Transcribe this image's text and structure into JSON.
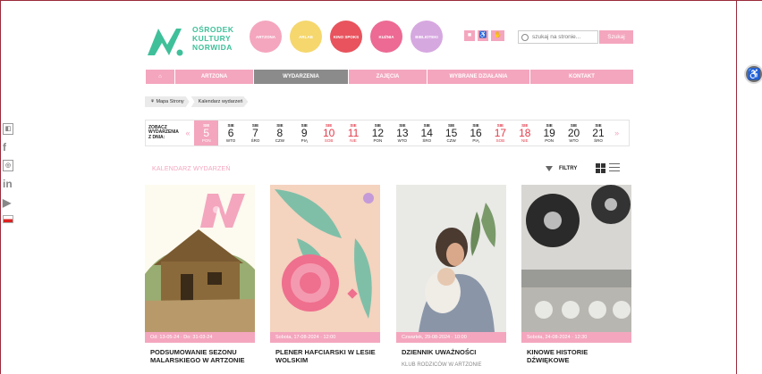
{
  "logo": {
    "line1": "OŚRODEK",
    "line2": "KULTURY",
    "line3": "NORWIDA"
  },
  "circles": [
    {
      "label": "ARTZONA",
      "color": "#f4a6be"
    },
    {
      "label": "ARLAB",
      "color": "#f5d76e"
    },
    {
      "label": "KINO SPOKS",
      "color": "#e8535d"
    },
    {
      "label": "KUŹNIA",
      "color": "#ec6a94"
    },
    {
      "label": "BIBLIOTEKI",
      "color": "#d6a8e0"
    }
  ],
  "search": {
    "placeholder": "szukaj na stronie...",
    "button": "Szukaj"
  },
  "nav": [
    {
      "label": "⌂",
      "active": false
    },
    {
      "label": "ARTZONA",
      "active": false
    },
    {
      "label": "WYDARZENIA",
      "active": true
    },
    {
      "label": "ZAJĘCIA",
      "active": false
    },
    {
      "label": "WYBRANE DZIAŁANIA",
      "active": false
    },
    {
      "label": "KONTAKT",
      "active": false
    }
  ],
  "breadcrumb": {
    "home": "Mapa Strony",
    "current": "Kalendarz wydarzeń"
  },
  "calendar": {
    "label": "ZOBACZ WYDARZENIA Z DNIA:",
    "days": [
      {
        "m": "SIE",
        "d": "5",
        "w": "PON",
        "red": false,
        "sel": true
      },
      {
        "m": "SIE",
        "d": "6",
        "w": "WTO",
        "red": false,
        "sel": false
      },
      {
        "m": "SIE",
        "d": "7",
        "w": "ŚRO",
        "red": false,
        "sel": false
      },
      {
        "m": "SIE",
        "d": "8",
        "w": "CZW",
        "red": false,
        "sel": false
      },
      {
        "m": "SIE",
        "d": "9",
        "w": "PIĄ",
        "red": false,
        "sel": false
      },
      {
        "m": "SIE",
        "d": "10",
        "w": "SOB",
        "red": true,
        "sel": false
      },
      {
        "m": "SIE",
        "d": "11",
        "w": "NIE",
        "red": true,
        "sel": false
      },
      {
        "m": "SIE",
        "d": "12",
        "w": "PON",
        "red": false,
        "sel": false
      },
      {
        "m": "SIE",
        "d": "13",
        "w": "WTO",
        "red": false,
        "sel": false
      },
      {
        "m": "SIE",
        "d": "14",
        "w": "ŚRO",
        "red": false,
        "sel": false
      },
      {
        "m": "SIE",
        "d": "15",
        "w": "CZW",
        "red": false,
        "sel": false
      },
      {
        "m": "SIE",
        "d": "16",
        "w": "PIĄ",
        "red": false,
        "sel": false
      },
      {
        "m": "SIE",
        "d": "17",
        "w": "SOB",
        "red": true,
        "sel": false
      },
      {
        "m": "SIE",
        "d": "18",
        "w": "NIE",
        "red": true,
        "sel": false
      },
      {
        "m": "SIE",
        "d": "19",
        "w": "PON",
        "red": false,
        "sel": false
      },
      {
        "m": "SIE",
        "d": "20",
        "w": "WTO",
        "red": false,
        "sel": false
      },
      {
        "m": "SIE",
        "d": "21",
        "w": "ŚRO",
        "red": false,
        "sel": false
      }
    ]
  },
  "section_title": "KALENDARZ WYDARZEŃ",
  "filter_label": "FILTRY",
  "cards": [
    {
      "date": "Od: 13-05-24 · Do: 31-03-24",
      "title": "PODSUMOWANIE SEZONU MALARSKIEGO W ARTZONIE",
      "sub": ""
    },
    {
      "date": "Sobota, 17-08-2024 · 12:00",
      "title": "PLENER HAFCIARSKI W LESIE WOLSKIM",
      "sub": ""
    },
    {
      "date": "Czwartek, 29-08-2024 · 10:00",
      "title": "DZIENNIK UWAŻNOŚCI",
      "sub": "KLUB RODZICÓW W ARTZONIE"
    },
    {
      "date": "Sobota, 24-08-2024 · 12:30",
      "title": "KINOWE HISTORIE DŹWIĘKOWE",
      "sub": ""
    }
  ]
}
